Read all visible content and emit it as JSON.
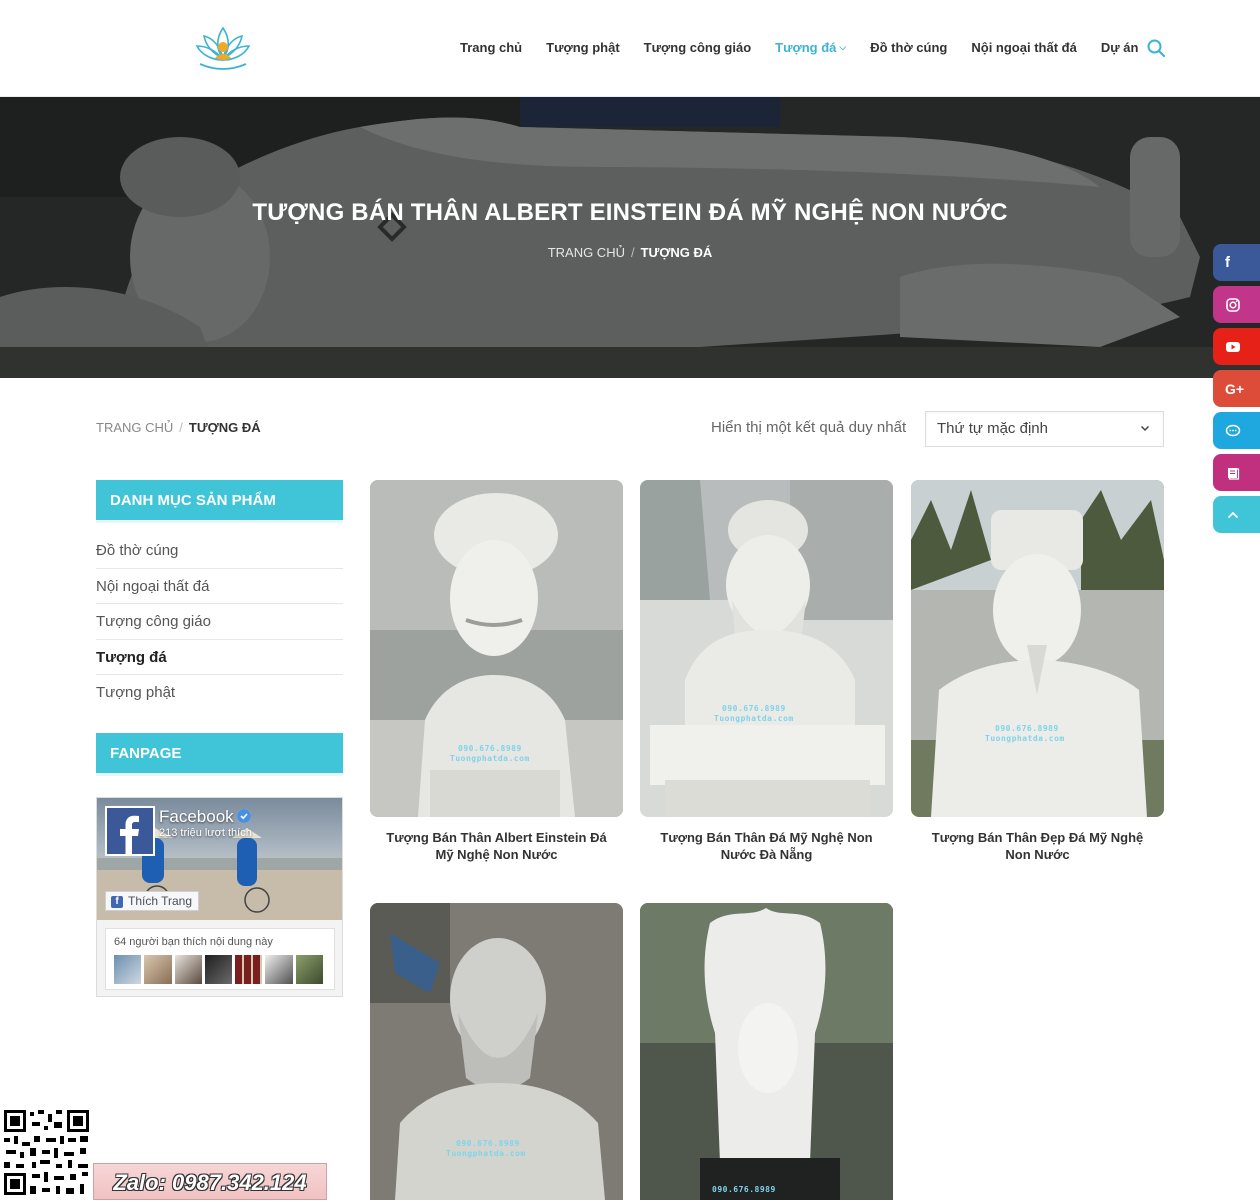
{
  "nav": {
    "items": [
      {
        "label": "Trang chủ"
      },
      {
        "label": "Tượng phật"
      },
      {
        "label": "Tượng công giáo"
      },
      {
        "label": "Tượng đá",
        "active": true
      },
      {
        "label": "Đồ thờ cúng"
      },
      {
        "label": "Nội ngoại thất đá"
      },
      {
        "label": "Dự án"
      }
    ],
    "search_icon": "search-icon"
  },
  "hero": {
    "title": "TƯỢNG BÁN THÂN ALBERT EINSTEIN ĐÁ MỸ NGHỆ NON NƯỚC",
    "crumb_home": "TRANG CHỦ",
    "crumb_sep": "/",
    "crumb_current": "TƯỢNG ĐÁ"
  },
  "toolbar": {
    "crumb_home": "TRANG CHỦ",
    "crumb_sep": "/",
    "crumb_current": "TƯỢNG ĐÁ",
    "result_count": "Hiển thị một kết quả duy nhất",
    "sort_selected": "Thứ tự mặc định"
  },
  "sidebar": {
    "categories_title": "DANH MỤC SẢN PHẨM",
    "categories": [
      {
        "label": "Đồ thờ cúng"
      },
      {
        "label": "Nội ngoại thất đá"
      },
      {
        "label": "Tượng công giáo"
      },
      {
        "label": "Tượng đá",
        "active": true
      },
      {
        "label": "Tượng phật"
      }
    ],
    "fanpage_title": "FANPAGE",
    "fb": {
      "name": "Facebook",
      "likes": "213 triệu lượt thích",
      "like_button": "Thích Trang",
      "friends_text": "64 người bạn thích nội dung này"
    }
  },
  "products": [
    {
      "title": "Tượng Bán Thân Albert Einstein Đá Mỹ Nghệ Non Nước"
    },
    {
      "title": "Tượng Bán Thân Đá Mỹ Nghệ Non Nước Đà Nẵng"
    },
    {
      "title": "Tượng Bán Thân Đẹp Đá Mỹ Nghệ Non Nước"
    },
    {
      "title": ""
    },
    {
      "title": ""
    }
  ],
  "social": [
    {
      "name": "facebook-icon",
      "color": "#3b5998"
    },
    {
      "name": "instagram-icon",
      "color": "#c1358a"
    },
    {
      "name": "youtube-icon",
      "color": "#e62117"
    },
    {
      "name": "google-plus-icon",
      "color": "#dd4b39"
    },
    {
      "name": "chat-icon",
      "color": "#1fa7e0"
    },
    {
      "name": "book-icon",
      "color": "#c0307e"
    },
    {
      "name": "back-to-top-icon",
      "color": "#3fc4d8"
    }
  ],
  "zalo": {
    "label": "Zalo: 0987.342.124"
  },
  "watermark": {
    "phone": "090.676.8989",
    "site": "Tuongphatda.com"
  },
  "colors": {
    "accent": "#3fc4d8",
    "nav_active": "#3cb3d6"
  }
}
